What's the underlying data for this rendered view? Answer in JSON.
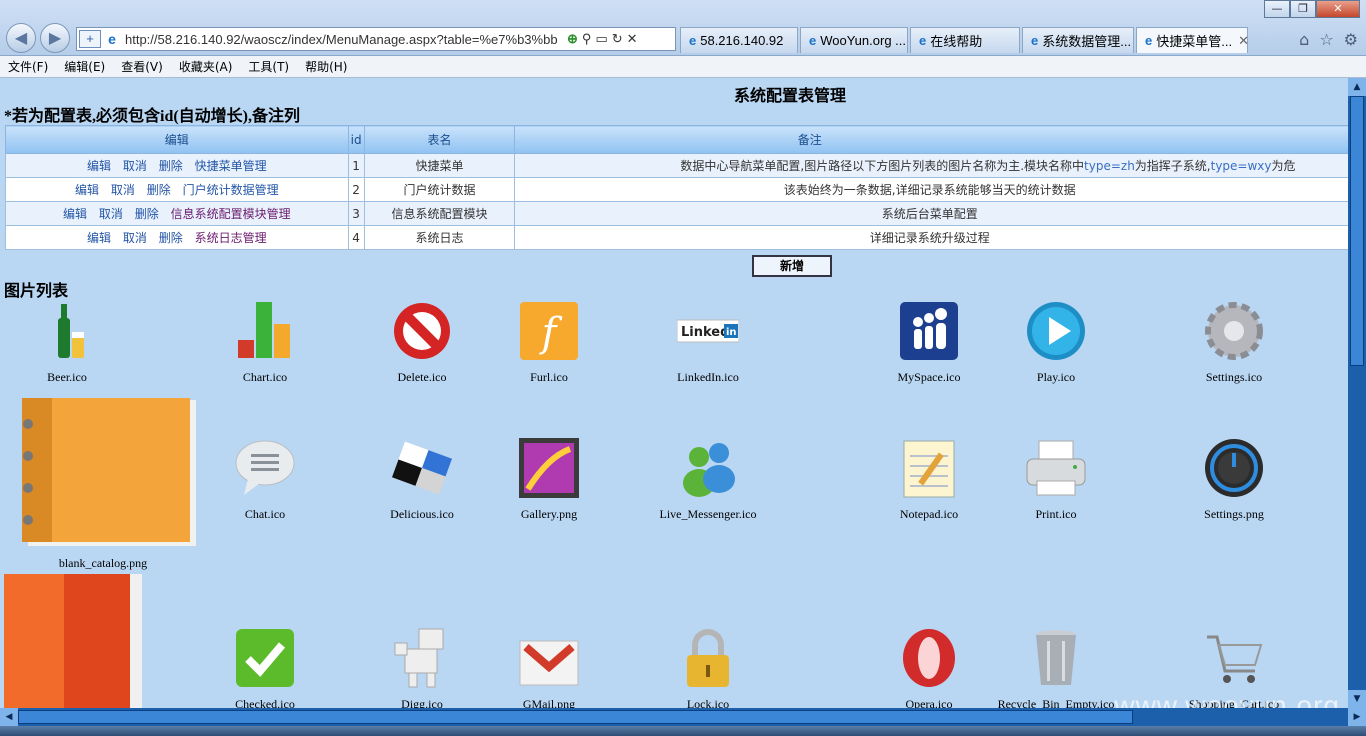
{
  "browser": {
    "window_controls": [
      "—",
      "❐",
      "✕"
    ],
    "address": "http://58.216.140.92/waoscz/index/MenuManage.aspx?table=%e7%b3%bb",
    "tabs": [
      {
        "label": "58.216.140.92"
      },
      {
        "label": "WooYun.org ..."
      },
      {
        "label": "在线帮助"
      },
      {
        "label": "系统数据管理..."
      },
      {
        "label": "快捷菜单管..."
      }
    ],
    "menu": [
      "文件(F)",
      "编辑(E)",
      "查看(V)",
      "收藏夹(A)",
      "工具(T)",
      "帮助(H)"
    ]
  },
  "page": {
    "title": "系统配置表管理",
    "notice": "*若为配置表,必须包含id(自动增长),备注列",
    "table": {
      "headers": {
        "edit": "编辑",
        "id": "id",
        "name": "表名",
        "remark": "备注"
      },
      "rows": [
        {
          "a1": "编辑",
          "a2": "取消",
          "a3": "删除",
          "link": "快捷菜单管理",
          "id": "1",
          "name": "快捷菜单",
          "remark": "数据中心导航菜单配置,图片路径以下方图片列表的图片名称为主.模块名称中",
          "code1": "type=zh",
          "remark2": "为指挥子系统,",
          "code2": "type=wxy",
          "remark3": "为危"
        },
        {
          "a1": "编辑",
          "a2": "取消",
          "a3": "删除",
          "link": "门户统计数据管理",
          "id": "2",
          "name": "门户统计数据",
          "remark": "该表始终为一条数据,详细记录系统能够当天的统计数据"
        },
        {
          "a1": "编辑",
          "a2": "取消",
          "a3": "删除",
          "link": "信息系统配置模块管理",
          "id": "3",
          "name": "信息系统配置模块",
          "remark": "系统后台菜单配置"
        },
        {
          "a1": "编辑",
          "a2": "取消",
          "a3": "删除",
          "link": "系统日志管理",
          "id": "4",
          "name": "系统日志",
          "remark": "详细记录系统升级过程"
        }
      ]
    },
    "add_button": "新增",
    "image_list_title": "图片列表",
    "images": [
      "Beer.ico",
      "Chart.ico",
      "Delete.ico",
      "Furl.ico",
      "LinkedIn.ico",
      "MySpace.ico",
      "Play.ico",
      "Settings.ico",
      "blank_catalog.png",
      "Chat.ico",
      "Delicious.ico",
      "Gallery.png",
      "Live_Messenger.ico",
      "Notepad.ico",
      "Print.ico",
      "Settings.png",
      "Checked.ico",
      "Digg.ico",
      "GMail.png",
      "Lock.ico",
      "Opera.ico",
      "Recycle_Bin_Empty.ico",
      "Shopping_Cart.ico"
    ],
    "watermark": "www.wooyun.org"
  }
}
